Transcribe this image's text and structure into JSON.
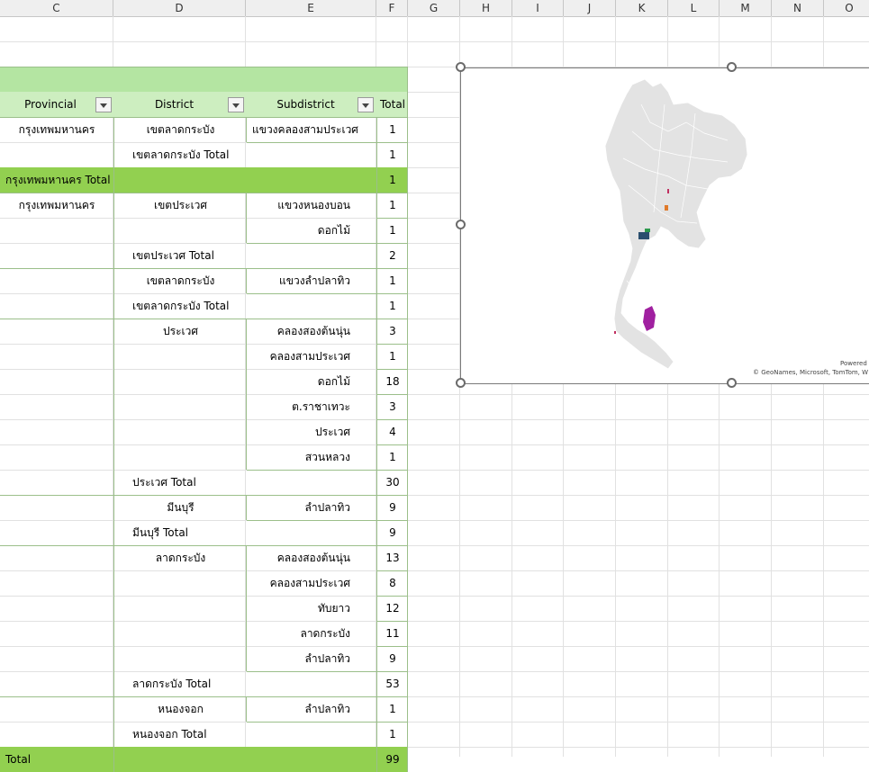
{
  "columns": [
    {
      "label": "C",
      "w": 126
    },
    {
      "label": "D",
      "w": 147
    },
    {
      "label": "E",
      "w": 145
    },
    {
      "label": "F",
      "w": 35
    },
    {
      "label": "G",
      "w": 58
    },
    {
      "label": "H",
      "w": 58
    },
    {
      "label": "I",
      "w": 57
    },
    {
      "label": "J",
      "w": 58
    },
    {
      "label": "K",
      "w": 58
    },
    {
      "label": "L",
      "w": 57
    },
    {
      "label": "M",
      "w": 58
    },
    {
      "label": "N",
      "w": 58
    },
    {
      "label": "O",
      "w": 57
    }
  ],
  "pivot": {
    "headers": {
      "provincial": "Provincial",
      "district": "District",
      "subdistrict": "Subdistrict",
      "total": "Total"
    },
    "rows": [
      {
        "type": "data",
        "provincial": "กรุงเทพมหานคร",
        "district": "เขตลาดกระบัง",
        "subdistrict": "แขวงคลองสามประเวศ",
        "total": "1"
      },
      {
        "type": "district_total",
        "district": "เขตลาดกระบัง Total",
        "total": "1"
      },
      {
        "type": "province_total",
        "provincial": "กรุงเทพมหานคร Total",
        "total": "1"
      },
      {
        "type": "data",
        "provincial": "กรุงเทพมหานคร",
        "district": "เขตประเวศ",
        "subdistrict": "แขวงหนองบอน",
        "total": "1"
      },
      {
        "type": "data",
        "subdistrict": "ดอกไม้",
        "total": "1"
      },
      {
        "type": "district_total",
        "district": "เขตประเวศ Total",
        "total": "2"
      },
      {
        "type": "data",
        "district": "เขตลาดกระบัง",
        "subdistrict": "แขวงลำปลาทิว",
        "total": "1"
      },
      {
        "type": "district_total",
        "district": "เขตลาดกระบัง Total",
        "total": "1"
      },
      {
        "type": "data",
        "district": "ประเวศ",
        "subdistrict": "คลองสองต้นนุ่น",
        "total": "3"
      },
      {
        "type": "data",
        "subdistrict": "คลองสามประเวศ",
        "total": "1"
      },
      {
        "type": "data",
        "subdistrict": "ดอกไม้",
        "total": "18"
      },
      {
        "type": "data",
        "subdistrict": "ต.ราชาเทวะ",
        "total": "3"
      },
      {
        "type": "data",
        "subdistrict": "ประเวศ",
        "total": "4"
      },
      {
        "type": "data",
        "subdistrict": "สวนหลวง",
        "total": "1"
      },
      {
        "type": "district_total",
        "district": "ประเวศ Total",
        "total": "30"
      },
      {
        "type": "data",
        "district": "มีนบุรี",
        "subdistrict": "ลำปลาทิว",
        "total": "9"
      },
      {
        "type": "district_total",
        "district": "มีนบุรี Total",
        "total": "9"
      },
      {
        "type": "data",
        "district": "ลาดกระบัง",
        "subdistrict": "คลองสองต้นนุ่น",
        "total": "13"
      },
      {
        "type": "data",
        "subdistrict": "คลองสามประเวศ",
        "total": "8"
      },
      {
        "type": "data",
        "subdistrict": "ทับยาว",
        "total": "12"
      },
      {
        "type": "data",
        "subdistrict": "ลาดกระบัง",
        "total": "11"
      },
      {
        "type": "data",
        "subdistrict": "ลำปลาทิว",
        "total": "9"
      },
      {
        "type": "district_total",
        "district": "ลาดกระบัง Total",
        "total": "53"
      },
      {
        "type": "data",
        "district": "หนองจอก",
        "subdistrict": "ลำปลาทิว",
        "total": "1"
      },
      {
        "type": "district_total",
        "district": "หนองจอก Total",
        "total": "1"
      },
      {
        "type": "grand_total",
        "provincial": "Total",
        "total": "99"
      }
    ]
  },
  "map": {
    "powered_text": "Powered",
    "attribution": "© GeoNames, Microsoft, TomTom, W",
    "land_color": "#e3e3e3",
    "highlight_colors": [
      "#a020a0",
      "#2a4e6e",
      "#2e9a4e",
      "#e07a2a",
      "#c03060",
      "#5a8ad0"
    ]
  }
}
